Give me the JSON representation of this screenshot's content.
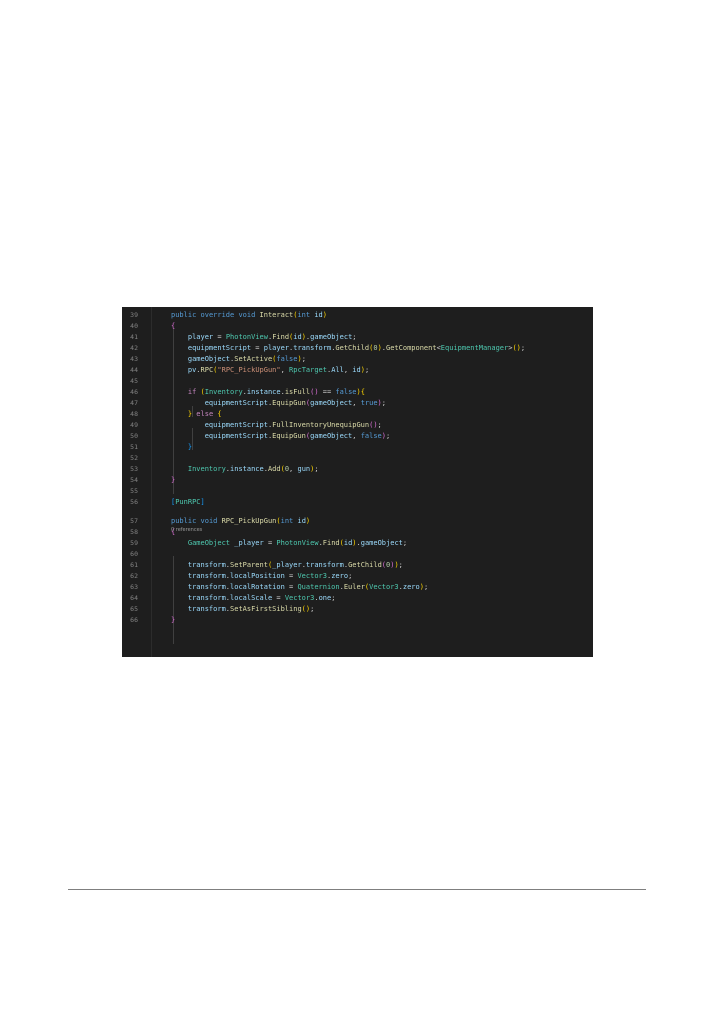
{
  "editor": {
    "lines": [
      {
        "n": "39",
        "segs": [
          [
            "kw",
            "public"
          ],
          [
            "tx",
            " "
          ],
          [
            "kw",
            "override"
          ],
          [
            "tx",
            " "
          ],
          [
            "kw",
            "void"
          ],
          [
            "tx",
            " "
          ],
          [
            "fn",
            "Interact"
          ],
          [
            "p2",
            "("
          ],
          [
            "kw",
            "int"
          ],
          [
            "tx",
            " "
          ],
          [
            "var",
            "id"
          ],
          [
            "p2",
            ")"
          ]
        ]
      },
      {
        "n": "40",
        "segs": [
          [
            "p1",
            "{"
          ]
        ]
      },
      {
        "n": "41",
        "segs": [
          [
            "tx",
            "    "
          ],
          [
            "var",
            "player"
          ],
          [
            "tx",
            " = "
          ],
          [
            "ty",
            "PhotonView"
          ],
          [
            "tx",
            "."
          ],
          [
            "fn",
            "Find"
          ],
          [
            "p2",
            "("
          ],
          [
            "var",
            "id"
          ],
          [
            "p2",
            ")"
          ],
          [
            "tx",
            "."
          ],
          [
            "var",
            "gameObject"
          ],
          [
            "tx",
            ";"
          ]
        ]
      },
      {
        "n": "42",
        "segs": [
          [
            "tx",
            "    "
          ],
          [
            "var",
            "equipmentScript"
          ],
          [
            "tx",
            " = "
          ],
          [
            "var",
            "player"
          ],
          [
            "tx",
            "."
          ],
          [
            "var",
            "transform"
          ],
          [
            "tx",
            "."
          ],
          [
            "fn",
            "GetChild"
          ],
          [
            "p2",
            "("
          ],
          [
            "num",
            "0"
          ],
          [
            "p2",
            ")"
          ],
          [
            "tx",
            "."
          ],
          [
            "fn",
            "GetComponent"
          ],
          [
            "tx",
            "<"
          ],
          [
            "ty",
            "EquipmentManager"
          ],
          [
            "tx",
            ">"
          ],
          [
            "p2",
            "("
          ],
          [
            "p2",
            ")"
          ],
          [
            "tx",
            ";"
          ]
        ]
      },
      {
        "n": "43",
        "segs": [
          [
            "tx",
            "    "
          ],
          [
            "var",
            "gameObject"
          ],
          [
            "tx",
            "."
          ],
          [
            "fn",
            "SetActive"
          ],
          [
            "p2",
            "("
          ],
          [
            "kw",
            "false"
          ],
          [
            "p2",
            ")"
          ],
          [
            "tx",
            ";"
          ]
        ]
      },
      {
        "n": "44",
        "segs": [
          [
            "tx",
            "    "
          ],
          [
            "var",
            "pv"
          ],
          [
            "tx",
            "."
          ],
          [
            "fn",
            "RPC"
          ],
          [
            "p2",
            "("
          ],
          [
            "str",
            "\"RPC_PickUpGun\""
          ],
          [
            "tx",
            ", "
          ],
          [
            "ty",
            "RpcTarget"
          ],
          [
            "tx",
            "."
          ],
          [
            "var",
            "All"
          ],
          [
            "tx",
            ", "
          ],
          [
            "var",
            "id"
          ],
          [
            "p2",
            ")"
          ],
          [
            "tx",
            ";"
          ]
        ]
      },
      {
        "n": "45",
        "segs": []
      },
      {
        "n": "46",
        "segs": [
          [
            "tx",
            "    "
          ],
          [
            "ctl",
            "if"
          ],
          [
            "tx",
            " "
          ],
          [
            "p2",
            "("
          ],
          [
            "ty",
            "Inventory"
          ],
          [
            "tx",
            "."
          ],
          [
            "var",
            "instance"
          ],
          [
            "tx",
            "."
          ],
          [
            "fn",
            "isFull"
          ],
          [
            "p1",
            "("
          ],
          [
            "p1",
            ")"
          ],
          [
            "tx",
            " == "
          ],
          [
            "kw",
            "false"
          ],
          [
            "p2",
            ")"
          ],
          [
            "p2",
            "{"
          ]
        ]
      },
      {
        "n": "47",
        "segs": [
          [
            "tx",
            "        "
          ],
          [
            "var",
            "equipmentScript"
          ],
          [
            "tx",
            "."
          ],
          [
            "fn",
            "EquipGun"
          ],
          [
            "p1",
            "("
          ],
          [
            "var",
            "gameObject"
          ],
          [
            "tx",
            ", "
          ],
          [
            "kw",
            "true"
          ],
          [
            "p1",
            ")"
          ],
          [
            "tx",
            ";"
          ]
        ]
      },
      {
        "n": "48",
        "segs": [
          [
            "tx",
            "    "
          ],
          [
            "p2",
            "}"
          ],
          [
            "tx",
            " "
          ],
          [
            "ctl",
            "else"
          ],
          [
            "tx",
            " "
          ],
          [
            "p2",
            "{"
          ]
        ]
      },
      {
        "n": "49",
        "segs": [
          [
            "tx",
            "        "
          ],
          [
            "var",
            "equipmentScript"
          ],
          [
            "tx",
            "."
          ],
          [
            "fn",
            "FullInventoryUnequipGun"
          ],
          [
            "p1",
            "("
          ],
          [
            "p1",
            ")"
          ],
          [
            "tx",
            ";"
          ]
        ]
      },
      {
        "n": "50",
        "segs": [
          [
            "tx",
            "        "
          ],
          [
            "var",
            "equipmentScript"
          ],
          [
            "tx",
            "."
          ],
          [
            "fn",
            "EquipGun"
          ],
          [
            "p1",
            "("
          ],
          [
            "var",
            "gameObject"
          ],
          [
            "tx",
            ", "
          ],
          [
            "kw",
            "false"
          ],
          [
            "p1",
            ")"
          ],
          [
            "tx",
            ";"
          ]
        ]
      },
      {
        "n": "51",
        "segs": [
          [
            "tx",
            "    "
          ],
          [
            "p3",
            "}"
          ]
        ]
      },
      {
        "n": "52",
        "segs": []
      },
      {
        "n": "53",
        "segs": [
          [
            "tx",
            "    "
          ],
          [
            "ty",
            "Inventory"
          ],
          [
            "tx",
            "."
          ],
          [
            "var",
            "instance"
          ],
          [
            "tx",
            "."
          ],
          [
            "fn",
            "Add"
          ],
          [
            "p2",
            "("
          ],
          [
            "num",
            "0"
          ],
          [
            "tx",
            ", "
          ],
          [
            "var",
            "gun"
          ],
          [
            "p2",
            ")"
          ],
          [
            "tx",
            ";"
          ]
        ]
      },
      {
        "n": "54",
        "segs": [
          [
            "p1",
            "}"
          ]
        ]
      },
      {
        "n": "55",
        "segs": []
      },
      {
        "n": "56",
        "segs": [
          [
            "p3",
            "["
          ],
          [
            "ty",
            "PunRPC"
          ],
          [
            "p3",
            "]"
          ]
        ]
      },
      {
        "n": "57",
        "segs": [
          [
            "kw",
            "public"
          ],
          [
            "tx",
            " "
          ],
          [
            "kw",
            "void"
          ],
          [
            "tx",
            " "
          ],
          [
            "fn",
            "RPC_PickUpGun"
          ],
          [
            "p2",
            "("
          ],
          [
            "kw",
            "int"
          ],
          [
            "tx",
            " "
          ],
          [
            "var",
            "id"
          ],
          [
            "p2",
            ")"
          ]
        ]
      },
      {
        "n": "58",
        "segs": [
          [
            "p1",
            "{"
          ]
        ]
      },
      {
        "n": "59",
        "segs": [
          [
            "tx",
            "    "
          ],
          [
            "ty",
            "GameObject"
          ],
          [
            "tx",
            " "
          ],
          [
            "var",
            "_player"
          ],
          [
            "tx",
            " = "
          ],
          [
            "ty",
            "PhotonView"
          ],
          [
            "tx",
            "."
          ],
          [
            "fn",
            "Find"
          ],
          [
            "p2",
            "("
          ],
          [
            "var",
            "id"
          ],
          [
            "p2",
            ")"
          ],
          [
            "tx",
            "."
          ],
          [
            "var",
            "gameObject"
          ],
          [
            "tx",
            ";"
          ]
        ]
      },
      {
        "n": "60",
        "segs": []
      },
      {
        "n": "61",
        "segs": [
          [
            "tx",
            "    "
          ],
          [
            "var",
            "transform"
          ],
          [
            "tx",
            "."
          ],
          [
            "fn",
            "SetParent"
          ],
          [
            "p2",
            "("
          ],
          [
            "var",
            "_player"
          ],
          [
            "tx",
            "."
          ],
          [
            "var",
            "transform"
          ],
          [
            "tx",
            "."
          ],
          [
            "fn",
            "GetChild"
          ],
          [
            "p1",
            "("
          ],
          [
            "num",
            "0"
          ],
          [
            "p1",
            ")"
          ],
          [
            "p2",
            ")"
          ],
          [
            "tx",
            ";"
          ]
        ]
      },
      {
        "n": "62",
        "segs": [
          [
            "tx",
            "    "
          ],
          [
            "var",
            "transform"
          ],
          [
            "tx",
            "."
          ],
          [
            "var",
            "localPosition"
          ],
          [
            "tx",
            " = "
          ],
          [
            "ty",
            "Vector3"
          ],
          [
            "tx",
            "."
          ],
          [
            "var",
            "zero"
          ],
          [
            "tx",
            ";"
          ]
        ]
      },
      {
        "n": "63",
        "segs": [
          [
            "tx",
            "    "
          ],
          [
            "var",
            "transform"
          ],
          [
            "tx",
            "."
          ],
          [
            "var",
            "localRotation"
          ],
          [
            "tx",
            " = "
          ],
          [
            "ty",
            "Quaternion"
          ],
          [
            "tx",
            "."
          ],
          [
            "fn",
            "Euler"
          ],
          [
            "p2",
            "("
          ],
          [
            "ty",
            "Vector3"
          ],
          [
            "tx",
            "."
          ],
          [
            "var",
            "zero"
          ],
          [
            "p2",
            ")"
          ],
          [
            "tx",
            ";"
          ]
        ]
      },
      {
        "n": "64",
        "segs": [
          [
            "tx",
            "    "
          ],
          [
            "var",
            "transform"
          ],
          [
            "tx",
            "."
          ],
          [
            "var",
            "localScale"
          ],
          [
            "tx",
            " = "
          ],
          [
            "ty",
            "Vector3"
          ],
          [
            "tx",
            "."
          ],
          [
            "var",
            "one"
          ],
          [
            "tx",
            ";"
          ]
        ]
      },
      {
        "n": "65",
        "segs": [
          [
            "tx",
            "    "
          ],
          [
            "var",
            "transform"
          ],
          [
            "tx",
            "."
          ],
          [
            "fn",
            "SetAsFirstSibling"
          ],
          [
            "p2",
            "("
          ],
          [
            "p2",
            ")"
          ],
          [
            "tx",
            ";"
          ]
        ]
      },
      {
        "n": "66",
        "segs": [
          [
            "p1",
            "}"
          ]
        ]
      }
    ],
    "codelens": "0 references",
    "colors": {
      "background": "#1e1e1e",
      "keyword": "#569cd6",
      "control": "#c586c0",
      "type": "#4ec9b0",
      "function": "#dcdcaa",
      "variable": "#9cdcfe",
      "string": "#ce9178",
      "number": "#b5cea8",
      "line_number": "#858585"
    }
  }
}
